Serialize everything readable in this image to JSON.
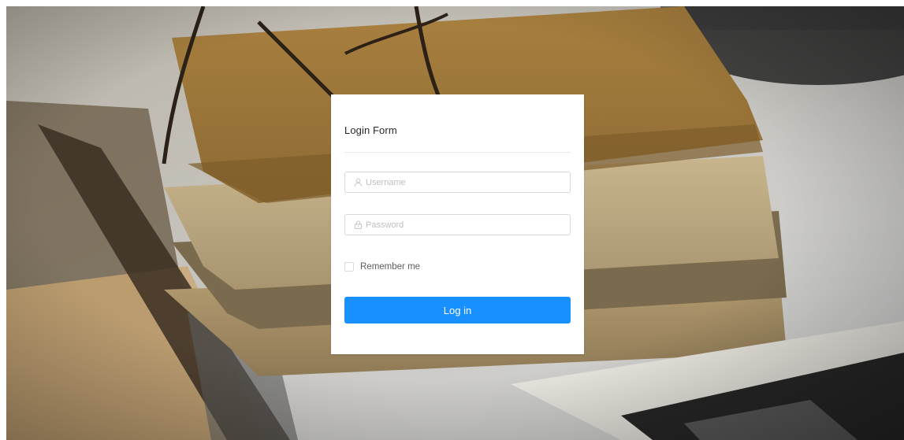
{
  "login_form": {
    "title": "Login Form",
    "username": {
      "placeholder": "Username",
      "value": "",
      "icon": "user-icon"
    },
    "password": {
      "placeholder": "Password",
      "value": "",
      "icon": "lock-icon"
    },
    "remember": {
      "label": "Remember me",
      "checked": false
    },
    "submit_label": "Log in"
  },
  "colors": {
    "primary": "#1890ff",
    "card_background": "#ffffff",
    "border": "#d9d9d9",
    "placeholder": "#bfbfbf"
  }
}
